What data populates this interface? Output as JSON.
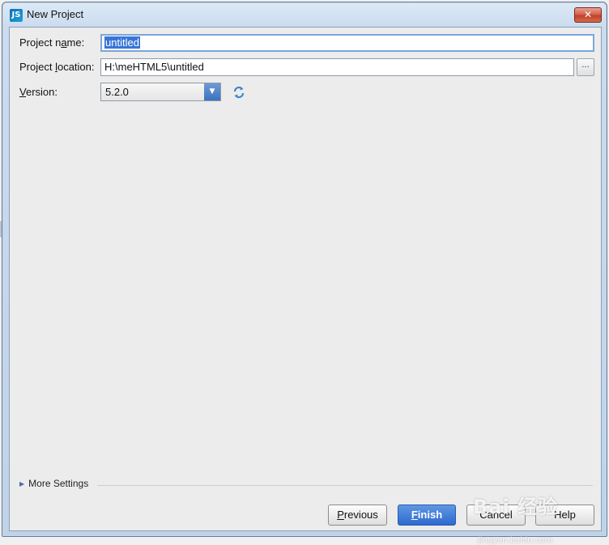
{
  "window": {
    "title": "New Project",
    "app_icon": "JS",
    "close_label": "✕"
  },
  "form": {
    "project_name": {
      "label_pre": "Project n",
      "label_key": "a",
      "label_post": "me:",
      "value": "untitled"
    },
    "project_location": {
      "label_pre": "Project ",
      "label_key": "l",
      "label_post": "ocation:",
      "value": "H:\\meHTML5\\untitled",
      "browse_label": "..."
    },
    "version": {
      "label_pre": "",
      "label_key": "V",
      "label_post": "ersion:",
      "value": "5.2.0"
    }
  },
  "more_settings": {
    "label": "More Settings"
  },
  "buttons": {
    "previous_key": "P",
    "previous_rest": "revious",
    "finish_key": "F",
    "finish_rest": "inish",
    "cancel": "Cancel",
    "help": "Help"
  },
  "watermark": {
    "text": "Bai 经验",
    "sub": "jingyan.baidu.com"
  },
  "colors": {
    "accent": "#3c72be",
    "finish_button": "#2e6ad0",
    "selection": "#3875d7"
  }
}
